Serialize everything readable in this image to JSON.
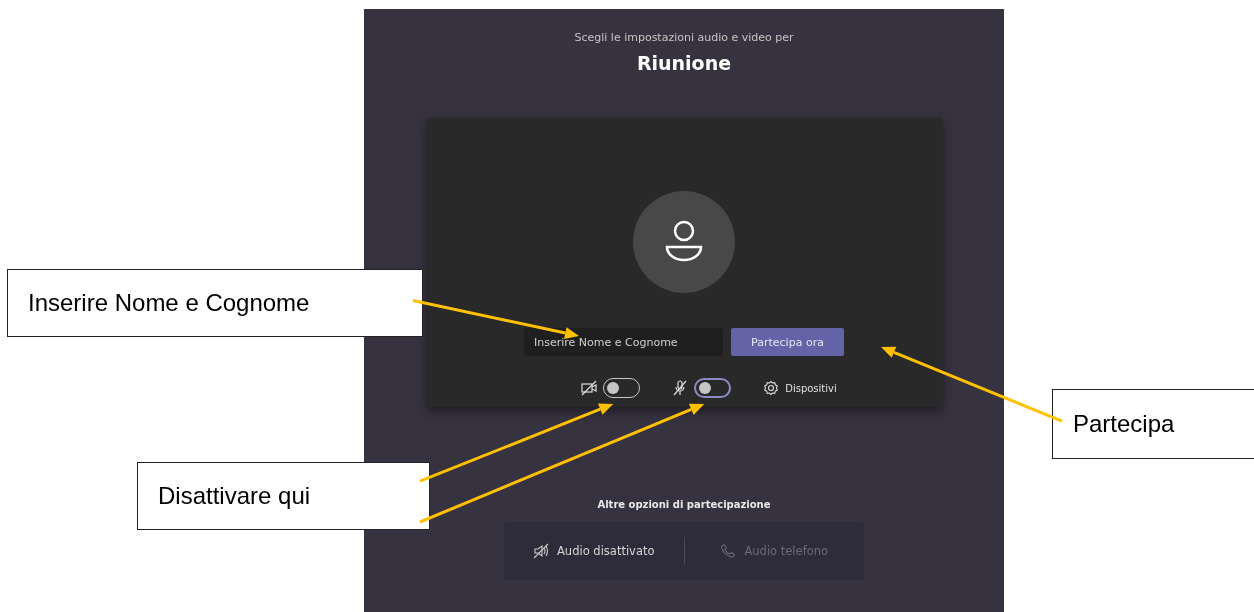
{
  "header": {
    "subtitle": "Scegli le impostazioni audio e video per",
    "title": "Riunione"
  },
  "preview": {
    "name_field": {
      "placeholder": "Inserire Nome e Cognome"
    },
    "join_button": "Partecipa ora",
    "toggles": [
      {
        "kind": "camera",
        "on": false,
        "focused": false
      },
      {
        "kind": "microphone",
        "on": false,
        "focused": true
      }
    ],
    "devices_link": "Dispositivi"
  },
  "other_options": {
    "heading": "Altre opzioni di partecipazione",
    "options": [
      {
        "kind": "audio-off",
        "label": "Audio disattivato",
        "disabled": false
      },
      {
        "kind": "phone",
        "label": "Audio telefono",
        "disabled": true
      }
    ]
  },
  "annotations": [
    {
      "text": "Inserire Nome e Cognome"
    },
    {
      "text": "Disattivare qui"
    },
    {
      "text": "Partecipa"
    }
  ]
}
